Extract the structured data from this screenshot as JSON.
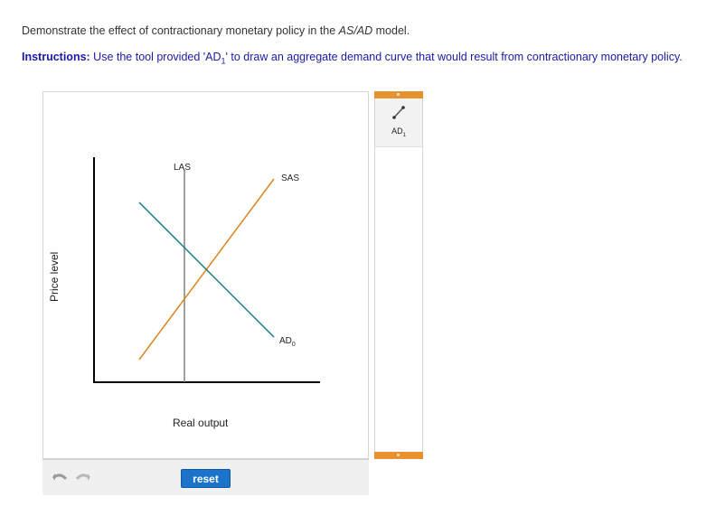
{
  "question": {
    "text_before": "Demonstrate the effect of contractionary monetary policy in the ",
    "model_name": "AS/AD",
    "text_after": " model."
  },
  "instructions": {
    "label": "Instructions:",
    "text_before": " Use the tool provided 'AD",
    "subscript": "1",
    "text_after": "' to draw an aggregate demand curve that would result from contractionary monetary policy."
  },
  "graph": {
    "y_axis_label": "Price level",
    "x_axis_label": "Real output",
    "curves": {
      "las": {
        "label": "LAS",
        "color": "#808080"
      },
      "sas": {
        "label": "SAS",
        "color": "#d9861a"
      },
      "ad0": {
        "label": "AD",
        "subscript": "0",
        "color": "#1b7a7a"
      }
    }
  },
  "toolbar": {
    "undo_icon": "undo-icon",
    "redo_icon": "redo-icon",
    "reset_label": "reset"
  },
  "tool_palette": {
    "tool_name": "AD",
    "tool_subscript": "1",
    "tool_icon": "line-draw-icon",
    "accent_color": "#e8922f"
  }
}
